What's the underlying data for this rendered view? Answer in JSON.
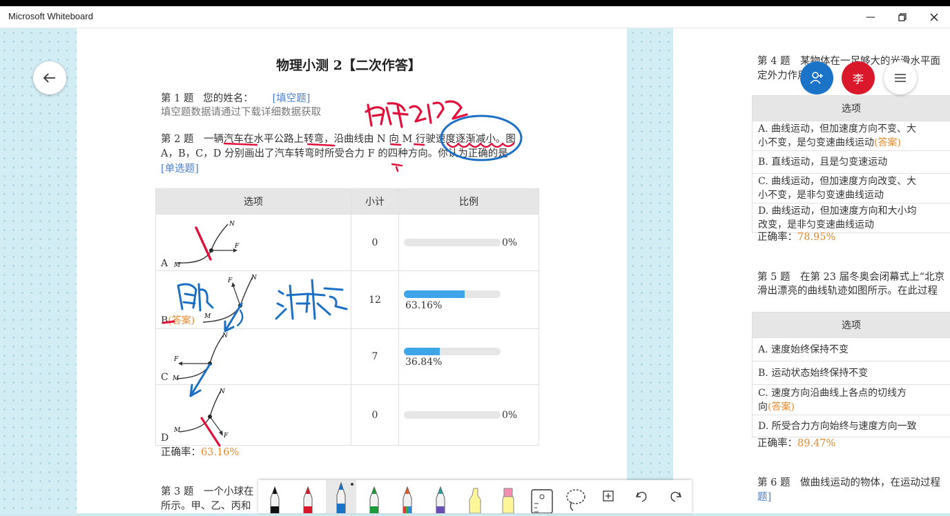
{
  "window": {
    "title": "Microsoft Whiteboard"
  },
  "page1": {
    "title": "物理小测 2【二次作答】",
    "q1": {
      "label": "第 1 题",
      "text": "您的姓名：",
      "type": "[填空题]",
      "note": "填空题数据请通过下载详细数据获取"
    },
    "q2": {
      "line1": "第 2 题　一辆汽车在水平公路上转弯，沿曲线由 N 向 M 行驶速度逐渐减小。图",
      "line2": "A，B，C，D 分别画出了汽车转弯时所受合力 F 的四种方向。你认为正确的是",
      "type": "[单选题]",
      "headers": [
        "选项",
        "小计",
        "比例"
      ],
      "rows": [
        {
          "label": "A",
          "answer": "",
          "count": "0",
          "pct": "0%",
          "value": 0
        },
        {
          "label": "B",
          "answer": "(答案)",
          "count": "12",
          "pct": "63.16%",
          "value": 63.16
        },
        {
          "label": "C",
          "answer": "",
          "count": "7",
          "pct": "36.84%",
          "value": 36.84
        },
        {
          "label": "D",
          "answer": "",
          "count": "0",
          "pct": "0%",
          "value": 0
        }
      ],
      "accuracy_label": "正确率：",
      "accuracy": "63.16%"
    },
    "q3": {
      "line1": "第 3 题　一个小球在",
      "line2": "所示。甲、乙、丙和"
    },
    "diagram_labels": {
      "n": "N",
      "f": "F",
      "m": "M"
    }
  },
  "page2": {
    "q4": {
      "line1": "第 4 题　某物体在一足够大的光滑水平面",
      "line2": "定外力作用，物　　　　　　（）",
      "header": "选项",
      "options": [
        {
          "text1": "A. 曲线运动，但加速度方向不变、大",
          "text2": "小不变，是匀变速曲线运动",
          "answer": "(答案)"
        },
        {
          "text1": "B. 直线运动，且是匀变速运动",
          "text2": "",
          "answer": ""
        },
        {
          "text1": "C. 曲线运动，但加速度方向改变、大",
          "text2": "小不变，是非匀变速曲线运动",
          "answer": ""
        },
        {
          "text1": "D. 曲线运动，但加速度方向和大小均",
          "text2": "改变，是非匀变速曲线运动",
          "answer": ""
        }
      ],
      "accuracy_label": "正确率：",
      "accuracy": "78.95%"
    },
    "q5": {
      "line1": "第 5 题　在第 23 届冬奥会闭幕式上“北京",
      "line2": "滑出漂亮的曲线轨迹如图所示。在此过程",
      "header": "选项",
      "options": [
        {
          "text1": "A. 速度始终保持不变",
          "text2": "",
          "answer": ""
        },
        {
          "text1": "B. 运动状态始终保持不变",
          "text2": "",
          "answer": ""
        },
        {
          "text1": "C. 速度方向沿曲线上各点的切线方",
          "text2": "向",
          "answer": "(答案)"
        },
        {
          "text1": "D. 所受合力方向始终与速度方向一致",
          "text2": "",
          "answer": ""
        }
      ],
      "accuracy_label": "正确率：",
      "accuracy": "89.47%"
    },
    "q6": {
      "line1": "第 6 题　做曲线运动的物体，在运动过程",
      "line2": "题]"
    }
  },
  "participants": {
    "avatar_initial": "李"
  },
  "colors": {
    "accent_blue": "#1a73c7",
    "avatar_red": "#d9192b",
    "bar_blue": "#3ea6e8",
    "answer_orange": "#e4892b",
    "link_blue": "#4a7fd0"
  },
  "icons": [
    "back-arrow-icon",
    "add-person-icon",
    "hamburger-menu-icon",
    "minimize-icon",
    "restore-icon",
    "close-icon",
    "pen-icon",
    "highlighter-icon",
    "ruler-icon",
    "lasso-icon",
    "insert-icon",
    "undo-icon",
    "redo-icon"
  ]
}
